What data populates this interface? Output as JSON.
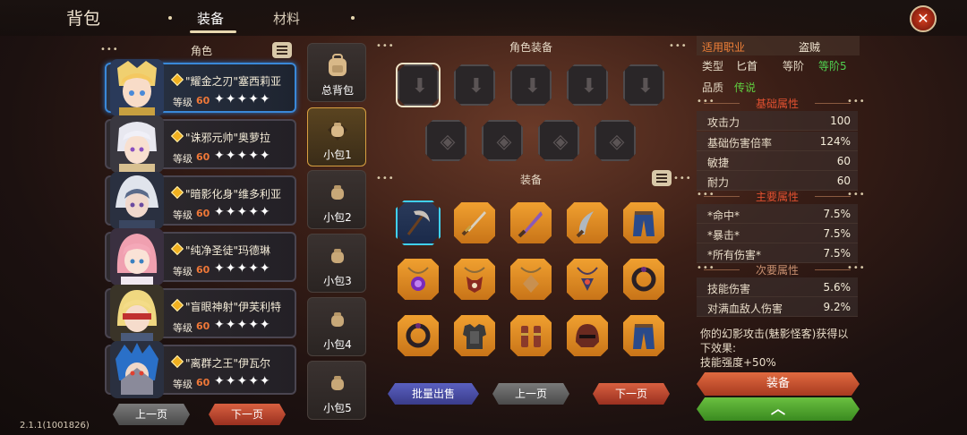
{
  "header": {
    "title": "背包",
    "tabs": [
      {
        "label": "装备",
        "active": true
      },
      {
        "label": "材料",
        "active": false
      }
    ],
    "close_icon": "close-x-icon"
  },
  "characters_panel": {
    "header": "角色",
    "items": [
      {
        "name": "\"耀金之刃\"塞西莉亚",
        "level_label": "等级",
        "level": "60",
        "stars": "✦✦✦✦✦",
        "selected": true
      },
      {
        "name": "\"诛邪元帅\"奥萝拉",
        "level_label": "等级",
        "level": "60",
        "stars": "✦✦✦✦✦",
        "selected": false
      },
      {
        "name": "\"暗影化身\"维多利亚",
        "level_label": "等级",
        "level": "60",
        "stars": "✦✦✦✦✦",
        "selected": false
      },
      {
        "name": "\"纯净圣徒\"玛德琳",
        "level_label": "等级",
        "level": "60",
        "stars": "✦✦✦✦✦",
        "selected": false
      },
      {
        "name": "\"盲眼神射\"伊芙利特",
        "level_label": "等级",
        "level": "60",
        "stars": "✦✦✦✦✦",
        "selected": false
      },
      {
        "name": "\"离群之王\"伊瓦尔",
        "level_label": "等级",
        "level": "60",
        "stars": "✦✦✦✦✦",
        "selected": false
      }
    ],
    "prev_label": "上一页",
    "next_label": "下一页"
  },
  "bags": [
    {
      "label": "总背包",
      "active": false
    },
    {
      "label": "小包1",
      "active": true
    },
    {
      "label": "小包2",
      "active": false
    },
    {
      "label": "小包3",
      "active": false
    },
    {
      "label": "小包4",
      "active": false
    },
    {
      "label": "小包5",
      "active": false
    }
  ],
  "character_equipment": {
    "header": "角色装备"
  },
  "equipment": {
    "header": "装备",
    "batch_sell_label": "批量出售",
    "prev_label": "上一页",
    "next_label": "下一页",
    "items": [
      "scythe-icon",
      "dagger-icon",
      "blade-icon",
      "curved-dagger-icon",
      "pants-icon",
      "amulet-icon",
      "bull-amulet-icon",
      "pendant-icon",
      "necklace-icon",
      "ring-icon",
      "ring-icon",
      "armor-icon",
      "bracers-icon",
      "helmet-icon",
      "pants-icon"
    ]
  },
  "details": {
    "class_label": "适用职业",
    "class_value": "盗贼",
    "type_label": "类型",
    "type_value": "匕首",
    "tier_label": "等阶",
    "tier_value": "等阶5",
    "quality_label": "品质",
    "quality_value": "传说",
    "basic_header": "基础属性",
    "basic_stats": [
      {
        "name": "攻击力",
        "value": "100"
      },
      {
        "name": "基础伤害倍率",
        "value": "124%"
      },
      {
        "name": "敏捷",
        "value": "60"
      },
      {
        "name": "耐力",
        "value": "60"
      }
    ],
    "main_header": "主要属性",
    "main_stats": [
      {
        "name": "*命中*",
        "value": "7.5%"
      },
      {
        "name": "*暴击*",
        "value": "7.5%"
      },
      {
        "name": "*所有伤害*",
        "value": "7.5%"
      }
    ],
    "secondary_header": "次要属性",
    "secondary_stats": [
      {
        "name": "技能伤害",
        "value": "5.6%"
      },
      {
        "name": "对满血敌人伤害",
        "value": "9.2%"
      }
    ],
    "description_1": "你的幻影攻击(魅影怪客)获得以",
    "description_2": "下效果:",
    "description_3": "技能强度+50%",
    "equip_label": "装备",
    "upgrade_icon": "chevron-up-icon"
  },
  "version": "2.1.1(1001826)"
}
